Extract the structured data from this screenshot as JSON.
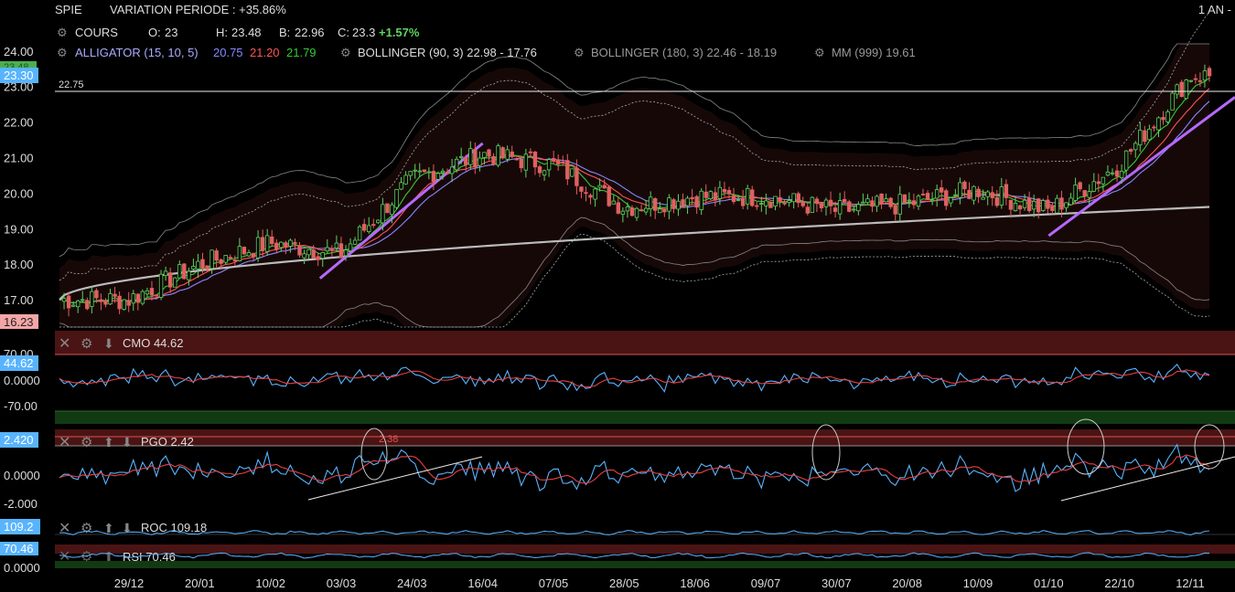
{
  "header": {
    "symbol": "SPIE",
    "variation": "VARIATION PERIODE : +35.86%",
    "period": "1 AN -"
  },
  "quote": {
    "label": "COURS",
    "o_label": "O:",
    "o": "23",
    "h_label": "H:",
    "h": "23.48",
    "b_label": "B:",
    "b": "22.96",
    "c_label": "C:",
    "c": "23.3",
    "change": "+1.57%"
  },
  "indicators": {
    "alligator_label": "ALLIGATOR (15, 10, 5)",
    "alligator_v1": "20.75",
    "alligator_v2": "21.20",
    "alligator_v3": "21.79",
    "bollinger90": "BOLLINGER (90, 3) 22.98 - 17.76",
    "bollinger180": "BOLLINGER (180, 3) 22.46 - 18.19",
    "mm999": "MM (999) 19.61"
  },
  "price_axis": {
    "ticks": [
      "24.00",
      "23.00",
      "22.00",
      "21.00",
      "20.00",
      "19.00",
      "18.00",
      "17.00"
    ],
    "badge_last": "23.30",
    "badge_green": "23.48",
    "badge_low": "16.23",
    "resistance_label": "22.75"
  },
  "panels": {
    "cmo": {
      "title": "CMO 44.62",
      "badge": "44.62",
      "ticks": [
        "70.00",
        "0.0000",
        "-70.00"
      ]
    },
    "pgo": {
      "title": "PGO 2.42",
      "badge": "2.420",
      "ticks": [
        "0.0000",
        "-2.000"
      ],
      "marker": "2.38"
    },
    "roc": {
      "title": "ROC 109.18",
      "badge": "109.2"
    },
    "rsi": {
      "title": "RSI 70.46",
      "badge": "70.46",
      "bottom_tick": "0.0000"
    }
  },
  "x_axis": {
    "labels": [
      "29/12",
      "20/01",
      "10/02",
      "03/03",
      "24/03",
      "16/04",
      "07/05",
      "28/05",
      "18/06",
      "09/07",
      "30/07",
      "20/08",
      "10/09",
      "01/10",
      "22/10",
      "12/11"
    ]
  },
  "colors": {
    "up": "#5fd35f",
    "down": "#e06060",
    "alligator1": "#8888ff",
    "alligator2": "#ff5555",
    "alligator3": "#33cc33",
    "trendline": "#b46aff",
    "mm999": "#bbbbbb",
    "badge_blue": "#58b4ff"
  },
  "chart_data": {
    "type": "candlestick",
    "title": "SPIE",
    "ylim": [
      16.23,
      24.2
    ],
    "anchors": [
      {
        "x": "29/12",
        "close": 17.0
      },
      {
        "x": "20/01",
        "close": 18.0
      },
      {
        "x": "10/02",
        "close": 18.6
      },
      {
        "x": "03/03",
        "close": 18.3
      },
      {
        "x": "24/03",
        "close": 20.4
      },
      {
        "x": "16/04",
        "close": 21.1
      },
      {
        "x": "07/05",
        "close": 20.8
      },
      {
        "x": "28/05",
        "close": 19.6
      },
      {
        "x": "18/06",
        "close": 19.9
      },
      {
        "x": "09/07",
        "close": 19.9
      },
      {
        "x": "30/07",
        "close": 19.5
      },
      {
        "x": "20/08",
        "close": 19.7
      },
      {
        "x": "10/09",
        "close": 20.1
      },
      {
        "x": "01/10",
        "close": 19.5
      },
      {
        "x": "22/10",
        "close": 20.8
      },
      {
        "x": "12/11",
        "close": 23.3
      }
    ],
    "resistance": 22.75,
    "trendlines": [
      {
        "from": {
          "x": "24/02",
          "y": 17.6
        },
        "to": {
          "x": "16/04",
          "y": 21.4
        }
      },
      {
        "from": {
          "x": "01/10",
          "y": 18.8
        },
        "to": {
          "x": "end",
          "y": 22.7
        }
      }
    ]
  }
}
